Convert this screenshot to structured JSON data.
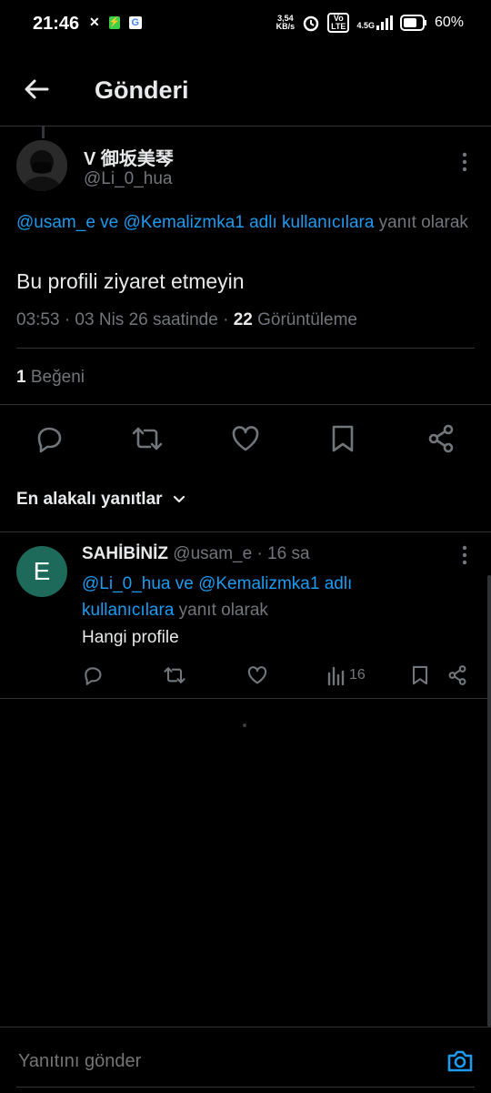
{
  "status_bar": {
    "time": "21:46",
    "net_speed_value": "3,54",
    "net_speed_unit": "KB/s",
    "volte_top": "Vo",
    "volte_bottom": "LTE",
    "network": "4.5G",
    "battery": "60%"
  },
  "header": {
    "title": "Gönderi"
  },
  "post": {
    "author_name": "V 御坂美琴",
    "author_handle": "@Li_0_hua",
    "reply_mentions": "@usam_e ve @Kemalizmka1 adlı kullanıcılara",
    "reply_suffix": " yanıt olarak",
    "text": "Bu profili ziyaret etmeyin",
    "timestamp": "03:53 · 03 Nis 26 saatinde · ",
    "views_count": "22",
    "views_label": " Görüntüleme",
    "likes_count": "1",
    "likes_label": " Beğeni"
  },
  "replies_sort": {
    "label": "En alakalı yanıtlar"
  },
  "reply": {
    "avatar_letter": "E",
    "author_name": "SAHİBİNİZ",
    "author_handle": "@usam_e",
    "time": " · 16 sa",
    "reply_mentions": "@Li_0_hua ve @Kemalizmka1 adlı kullanıcılara",
    "reply_suffix": " yanıt olarak",
    "text": "Hangi profile",
    "views_count": "16"
  },
  "composer": {
    "placeholder": "Yanıtını gönder"
  },
  "colors": {
    "accent": "#1d9bf0",
    "muted": "#71767b",
    "text": "#e7e9ea",
    "reply_avatar": "#1e6a5a"
  },
  "icons": [
    "back-arrow-icon",
    "more-vertical-icon",
    "reply-icon",
    "retweet-icon",
    "like-icon",
    "bookmark-icon",
    "share-icon",
    "views-icon",
    "chevron-down-icon",
    "camera-icon"
  ]
}
